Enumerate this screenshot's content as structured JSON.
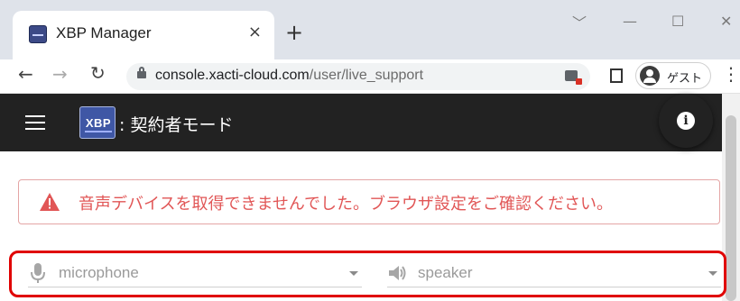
{
  "browser": {
    "tab_title": "XBP Manager",
    "tab_close": "×",
    "new_tab": "+",
    "window_controls": {
      "chevron": "﹀",
      "minimize": "—",
      "maximize": "☐",
      "close": "✕"
    },
    "url_host": "console.xacti-cloud.com",
    "url_path": "/user/live_support",
    "profile_label": "ゲスト",
    "nav": {
      "back": "←",
      "forward": "→",
      "reload": "↻",
      "menu": "⋮"
    }
  },
  "app": {
    "logo_text": "XBP",
    "title": ": 契約者モード",
    "info_icon": "i"
  },
  "alert": {
    "message": "音声デバイスを取得できませんでした。ブラウザ設定をご確認ください。",
    "color": "#e15656"
  },
  "devices": {
    "microphone_placeholder": "microphone",
    "speaker_placeholder": "speaker",
    "highlight_color": "#e00000"
  }
}
